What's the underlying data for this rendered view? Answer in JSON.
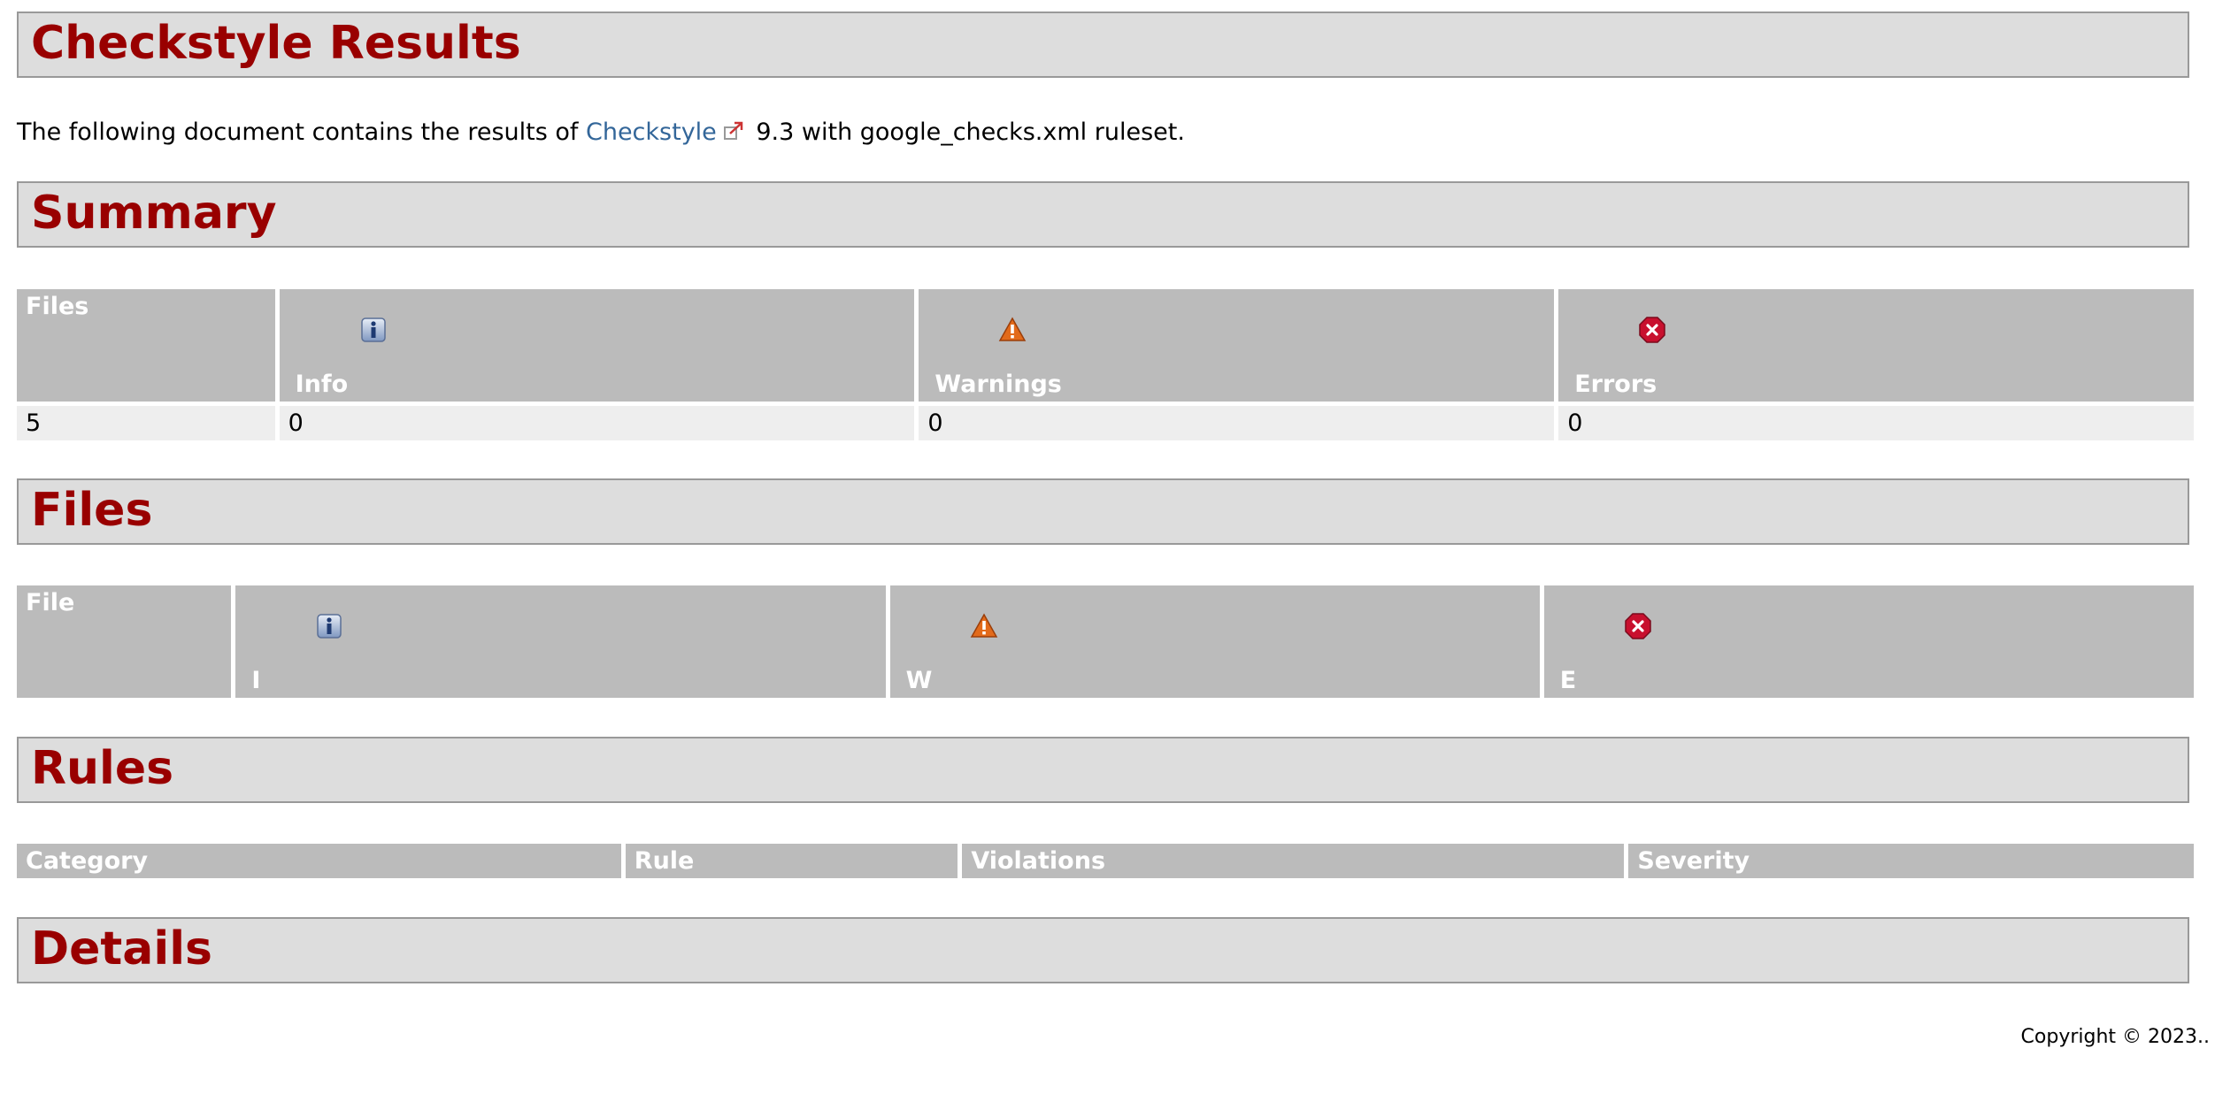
{
  "title": "Checkstyle Results",
  "intro": {
    "before": "The following document contains the results of ",
    "link_text": "Checkstyle",
    "after": " 9.3 with google_checks.xml ruleset."
  },
  "sections": {
    "summary": "Summary",
    "files": "Files",
    "rules": "Rules",
    "details": "Details"
  },
  "summary_table": {
    "headers": [
      "Files",
      "Info",
      "Warnings",
      "Errors"
    ],
    "row": [
      "5",
      "0",
      "0",
      "0"
    ]
  },
  "files_table": {
    "headers": [
      "File",
      "I",
      "W",
      "E"
    ]
  },
  "rules_table": {
    "headers": [
      "Category",
      "Rule",
      "Violations",
      "Severity"
    ]
  },
  "icons": {
    "info": "info-icon",
    "warning": "warning-icon",
    "error": "error-icon",
    "external": "external-link-icon"
  },
  "colors": {
    "heading": "#990000",
    "header_bg": "#dddddd",
    "table_header": "#bbbbbb",
    "table_row": "#eeeeee",
    "link": "#336699"
  },
  "footer": {
    "copyright": "Copyright © 2023.."
  }
}
